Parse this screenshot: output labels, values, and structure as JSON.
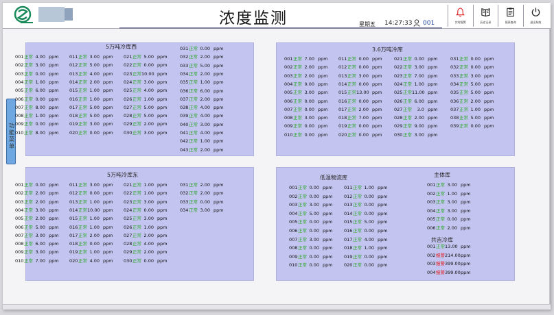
{
  "header": {
    "title": "浓度监测",
    "weekday": "星期五",
    "time": "14:27:33",
    "user_id": "001",
    "buttons": [
      {
        "icon": "alarm-bell-icon",
        "label": "实时报警"
      },
      {
        "icon": "history-book-icon",
        "label": "历史记录"
      },
      {
        "icon": "report-clipboard-icon",
        "label": "报表查询"
      },
      {
        "icon": "power-icon",
        "label": "退出系统"
      }
    ]
  },
  "side_tab": {
    "label": "功能菜单"
  },
  "colors": {
    "normal": "#2fa82f",
    "alarm": "#e02020",
    "panel": "#c4c4f0"
  },
  "panels": [
    {
      "title": "5万吨冷库西",
      "columns": [
        [
          [
            "001",
            "正常",
            "4.00",
            "ppm"
          ],
          [
            "002",
            "正常",
            "3.00",
            "ppm"
          ],
          [
            "003",
            "正常",
            "0.00",
            "ppm"
          ],
          [
            "004",
            "正常",
            "1.00",
            "ppm"
          ],
          [
            "005",
            "正常",
            "6.00",
            "ppm"
          ],
          [
            "006",
            "正常",
            "0.00",
            "ppm"
          ],
          [
            "007",
            "正常",
            "8.00",
            "ppm"
          ],
          [
            "008",
            "正常",
            "1.00",
            "ppm"
          ],
          [
            "009",
            "正常",
            "0.00",
            "ppm"
          ],
          [
            "010",
            "正常",
            "8.00",
            "ppm"
          ]
        ],
        [
          [
            "011",
            "正常",
            "3.00",
            "ppm"
          ],
          [
            "012",
            "正常",
            "5.00",
            "ppm"
          ],
          [
            "013",
            "正常",
            "4.00",
            "ppm"
          ],
          [
            "014",
            "正常",
            "2.00",
            "ppm"
          ],
          [
            "015",
            "正常",
            "1.00",
            "ppm"
          ],
          [
            "016",
            "正常",
            "1.00",
            "ppm"
          ],
          [
            "017",
            "正常",
            "5.00",
            "ppm"
          ],
          [
            "018",
            "正常",
            "5.00",
            "ppm"
          ],
          [
            "019",
            "正常",
            "3.00",
            "ppm"
          ],
          [
            "020",
            "正常",
            "0.00",
            "ppm"
          ]
        ],
        [
          [
            "021",
            "正常",
            "5.00",
            "ppm"
          ],
          [
            "022",
            "正常",
            "0.00",
            "ppm"
          ],
          [
            "023",
            "正常",
            "10.00",
            "ppm"
          ],
          [
            "024",
            "正常",
            "3.00",
            "ppm"
          ],
          [
            "025",
            "正常",
            "4.00",
            "ppm"
          ],
          [
            "026",
            "正常",
            "1.00",
            "ppm"
          ],
          [
            "027",
            "正常",
            "5.00",
            "ppm"
          ],
          [
            "028",
            "正常",
            "5.00",
            "ppm"
          ],
          [
            "029",
            "正常",
            "2.00",
            "ppm"
          ],
          [
            "030",
            "正常",
            "3.00",
            "ppm"
          ]
        ],
        [
          [
            "031",
            "正常",
            "0.00",
            "ppm"
          ],
          [
            "032",
            "正常",
            "2.00",
            "ppm"
          ],
          [
            "033",
            "正常",
            "5.00",
            "ppm"
          ],
          [
            "034",
            "正常",
            "2.00",
            "ppm"
          ],
          [
            "035",
            "正常",
            "1.00",
            "ppm"
          ],
          [
            "036",
            "正常",
            "6.00",
            "ppm"
          ],
          [
            "037",
            "正常",
            "2.00",
            "ppm"
          ],
          [
            "038",
            "正常",
            "4.00",
            "ppm"
          ],
          [
            "039",
            "正常",
            "4.00",
            "ppm"
          ],
          [
            "040",
            "正常",
            "3.00",
            "ppm"
          ],
          [
            "041",
            "正常",
            "4.00",
            "ppm"
          ],
          [
            "042",
            "正常",
            "1.00",
            "ppm"
          ],
          [
            "043",
            "正常",
            "2.00",
            "ppm"
          ]
        ]
      ]
    },
    {
      "title": "3.6万吨冷库",
      "columns": [
        [
          [
            "001",
            "正常",
            "7.00",
            "ppm"
          ],
          [
            "002",
            "正常",
            "2.00",
            "ppm"
          ],
          [
            "003",
            "正常",
            "2.00",
            "ppm"
          ],
          [
            "004",
            "正常",
            "0.00",
            "ppm"
          ],
          [
            "005",
            "正常",
            "3.00",
            "ppm"
          ],
          [
            "006",
            "正常",
            "0.00",
            "ppm"
          ],
          [
            "007",
            "正常",
            "0.00",
            "ppm"
          ],
          [
            "008",
            "正常",
            "3.00",
            "ppm"
          ],
          [
            "009",
            "正常",
            "0.00",
            "ppm"
          ],
          [
            "010",
            "正常",
            "0.00",
            "ppm"
          ]
        ],
        [
          [
            "011",
            "正常",
            "0.00",
            "ppm"
          ],
          [
            "012",
            "正常",
            "0.00",
            "ppm"
          ],
          [
            "013",
            "正常",
            "3.00",
            "ppm"
          ],
          [
            "014",
            "正常",
            "0.00",
            "ppm"
          ],
          [
            "015",
            "正常",
            "13.00",
            "ppm"
          ],
          [
            "016",
            "正常",
            "0.00",
            "ppm"
          ],
          [
            "017",
            "正常",
            "2.00",
            "ppm"
          ],
          [
            "018",
            "正常",
            "7.00",
            "ppm"
          ],
          [
            "019",
            "正常",
            "0.00",
            "ppm"
          ],
          [
            "020",
            "正常",
            "0.00",
            "ppm"
          ]
        ],
        [
          [
            "021",
            "正常",
            "0.00",
            "ppm"
          ],
          [
            "022",
            "正常",
            "3.00",
            "ppm"
          ],
          [
            "023",
            "正常",
            "7.00",
            "ppm"
          ],
          [
            "024",
            "正常",
            "1.00",
            "ppm"
          ],
          [
            "025",
            "正常",
            "11.00",
            "ppm"
          ],
          [
            "026",
            "正常",
            "6.00",
            "ppm"
          ],
          [
            "027",
            "正常",
            "3.0",
            "ppm"
          ],
          [
            "028",
            "正常",
            "2.00",
            "ppm"
          ],
          [
            "029",
            "正常",
            "9.00",
            "ppm"
          ],
          [
            "030",
            "正常",
            "3.00",
            "ppm"
          ]
        ],
        [
          [
            "031",
            "正常",
            "0.00",
            "ppm"
          ],
          [
            "032",
            "正常",
            "0.00",
            "ppm"
          ],
          [
            "033",
            "正常",
            "3.00",
            "ppm"
          ],
          [
            "034",
            "正常",
            "5.00",
            "ppm"
          ],
          [
            "035",
            "正常",
            "5.00",
            "ppm"
          ],
          [
            "036",
            "正常",
            "2.00",
            "ppm"
          ],
          [
            "037",
            "正常",
            "1.00",
            "ppm"
          ],
          [
            "038",
            "正常",
            "5.00",
            "ppm"
          ],
          [
            "039",
            "正常",
            "0.00",
            "ppm"
          ]
        ]
      ]
    },
    {
      "title": "5万吨冷库东",
      "columns": [
        [
          [
            "001",
            "正常",
            "0.00",
            "ppm"
          ],
          [
            "002",
            "正常",
            "2.00",
            "ppm"
          ],
          [
            "003",
            "正常",
            "2.00",
            "ppm"
          ],
          [
            "004",
            "正常",
            "3.00",
            "ppm"
          ],
          [
            "005",
            "正常",
            "2.00",
            "ppm"
          ],
          [
            "006",
            "正常",
            "5.00",
            "ppm"
          ],
          [
            "007",
            "正常",
            "3.00",
            "ppm"
          ],
          [
            "008",
            "正常",
            "6.00",
            "ppm"
          ],
          [
            "009",
            "正常",
            "3.00",
            "ppm"
          ],
          [
            "010",
            "正常",
            "7.00",
            "ppm"
          ]
        ],
        [
          [
            "011",
            "正常",
            "3.00",
            "ppm"
          ],
          [
            "012",
            "正常",
            "0.00",
            "ppm"
          ],
          [
            "013",
            "正常",
            "1.00",
            "ppm"
          ],
          [
            "014",
            "正常",
            "10.00",
            "ppm"
          ],
          [
            "015",
            "正常",
            "1.00",
            "ppm"
          ],
          [
            "016",
            "正常",
            "1.00",
            "ppm"
          ],
          [
            "017",
            "正常",
            "2.00",
            "ppm"
          ],
          [
            "018",
            "正常",
            "0.00",
            "ppm"
          ],
          [
            "019",
            "正常",
            "1.00",
            "ppm"
          ],
          [
            "020",
            "正常",
            "4.00",
            "ppm"
          ]
        ],
        [
          [
            "021",
            "正常",
            "1.00",
            "ppm"
          ],
          [
            "022",
            "正常",
            "1.00",
            "ppm"
          ],
          [
            "023",
            "正常",
            "3.00",
            "ppm"
          ],
          [
            "024",
            "正常",
            "0.00",
            "ppm"
          ],
          [
            "025",
            "正常",
            "3.00",
            "ppm"
          ],
          [
            "026",
            "正常",
            "1.00",
            "ppm"
          ],
          [
            "027",
            "正常",
            "2.00",
            "ppm"
          ],
          [
            "028",
            "正常",
            "4.00",
            "ppm"
          ],
          [
            "029",
            "正常",
            "2.00",
            "ppm"
          ],
          [
            "030",
            "正常",
            "0.00",
            "ppm"
          ]
        ],
        [
          [
            "031",
            "正常",
            "2.00",
            "ppm"
          ],
          [
            "032",
            "正常",
            "2.00",
            "ppm"
          ],
          [
            "033",
            "正常",
            "0.00",
            "ppm"
          ],
          [
            "034",
            "正常",
            "3.00",
            "ppm"
          ]
        ]
      ]
    },
    {
      "title": "低温物流库",
      "columns": [
        [
          [
            "001",
            "正常",
            "0.00",
            "ppm"
          ],
          [
            "002",
            "正常",
            "0.00",
            "ppm"
          ],
          [
            "003",
            "正常",
            "3.00",
            "ppm"
          ],
          [
            "004",
            "正常",
            "5.00",
            "ppm"
          ],
          [
            "005",
            "正常",
            "0.00",
            "ppm"
          ],
          [
            "006",
            "正常",
            "0.00",
            "ppm"
          ],
          [
            "007",
            "正常",
            "3.00",
            "ppm"
          ],
          [
            "008",
            "正常",
            "0.00",
            "ppm"
          ],
          [
            "009",
            "正常",
            "0.00",
            "ppm"
          ],
          [
            "010",
            "正常",
            "0.00",
            "ppm"
          ]
        ],
        [
          [
            "011",
            "正常",
            "1.00",
            "ppm"
          ],
          [
            "012",
            "正常",
            "0.00",
            "ppm"
          ],
          [
            "013",
            "正常",
            "0.00",
            "ppm"
          ],
          [
            "014",
            "正常",
            "0.00",
            "ppm"
          ],
          [
            "015",
            "正常",
            "5.00",
            "ppm"
          ],
          [
            "016",
            "正常",
            "0.00",
            "ppm"
          ],
          [
            "017",
            "正常",
            "4.00",
            "ppm"
          ],
          [
            "018",
            "正常",
            "1.00",
            "ppm"
          ],
          [
            "019",
            "正常",
            "0.00",
            "ppm"
          ],
          [
            "020",
            "正常",
            "0.00",
            "ppm"
          ]
        ]
      ]
    },
    {
      "title": "主体库",
      "columns": [
        [
          [
            "001",
            "正常",
            "3.00",
            "ppm"
          ],
          [
            "002",
            "正常",
            "1.00",
            "ppm"
          ],
          [
            "003",
            "正常",
            "3.00",
            "ppm"
          ],
          [
            "004",
            "正常",
            "3.00",
            "ppm"
          ],
          [
            "005",
            "正常",
            "0.00",
            "ppm"
          ],
          [
            "006",
            "正常",
            "2.00",
            "ppm"
          ]
        ]
      ]
    },
    {
      "title": "共吉冷库",
      "columns": [
        [
          [
            "001",
            "正常",
            "13.00",
            "ppm"
          ],
          [
            "002",
            "报警",
            "214.00",
            "ppm"
          ],
          [
            "003",
            "报警",
            "399.00",
            "ppm"
          ],
          [
            "004",
            "报警",
            "399.00",
            "ppm"
          ]
        ]
      ]
    }
  ]
}
